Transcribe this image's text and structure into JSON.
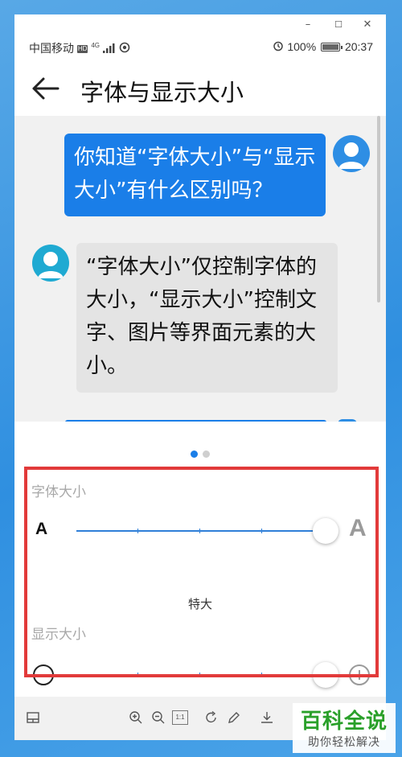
{
  "window": {
    "minimize_glyph": "–",
    "maximize_glyph": "☐",
    "close_glyph": "✕"
  },
  "status_bar": {
    "carrier": "中国移动",
    "hd_badge": "HD",
    "network_badge": "4G",
    "battery_percent": "100%",
    "time": "20:37",
    "icons": [
      "hd-icon",
      "signal-icon",
      "sync-icon",
      "alarm-icon",
      "battery-icon"
    ]
  },
  "app_bar": {
    "title": "字体与显示大小",
    "back_icon": "back-arrow-icon"
  },
  "preview": {
    "question": "你知道“字体大小”与“显示大小”有什么区别吗？",
    "answer": "“字体大小”仅控制字体的大小，“显示大小”控制文字、图片等界面元素的大小。",
    "page_indicator": {
      "total": 2,
      "active": 1
    }
  },
  "font_size": {
    "label": "字体大小",
    "small_glyph": "A",
    "large_glyph": "A",
    "value_label": "特大",
    "level": 1.0
  },
  "display_size": {
    "label": "显示大小",
    "minus_icon": "zoom-out-icon",
    "plus_icon": "zoom-in-icon",
    "value_label": "+",
    "level": 1.0
  },
  "toolbar": {
    "icons": [
      "panel-icon",
      "zoom-in-icon",
      "zoom-out-icon",
      "actual-size-icon",
      "rotate-icon",
      "edit-icon",
      "download-icon"
    ],
    "actual_size_label": "1:1"
  },
  "watermark": {
    "title": "百科全说",
    "subtitle": "助你轻松解决"
  },
  "colors": {
    "accent": "#1a7ee8",
    "slider_track": "#2f7fd8",
    "highlight_border": "#e23a3a",
    "watermark_green": "#2aa02a"
  }
}
